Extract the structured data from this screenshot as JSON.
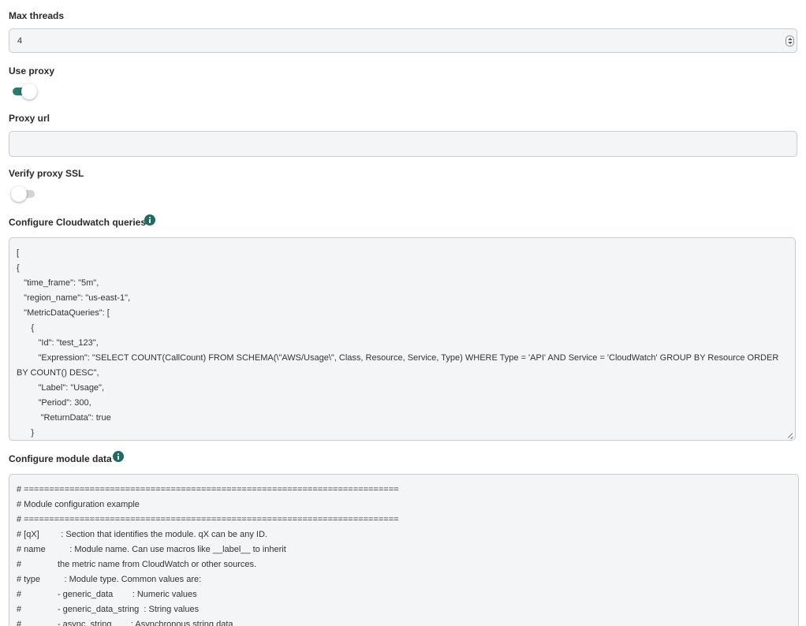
{
  "max_threads": {
    "label": "Max threads",
    "value": "4"
  },
  "use_proxy": {
    "label": "Use proxy",
    "enabled": true
  },
  "proxy_url": {
    "label": "Proxy url",
    "value": ""
  },
  "verify_proxy_ssl": {
    "label": "Verify proxy SSL",
    "enabled": false
  },
  "cloudwatch_queries": {
    "label": "Configure Cloudwatch queries",
    "content": "[\n{\n   \"time_frame\": \"5m\",\n   \"region_name\": \"us-east-1\",\n   \"MetricDataQueries\": [\n      {\n         \"Id\": \"test_123\",\n         \"Expression\": \"SELECT COUNT(CallCount) FROM SCHEMA(\\\"AWS/Usage\\\", Class, Resource, Service, Type) WHERE Type = 'API' AND Service = 'CloudWatch' GROUP BY Resource ORDER BY COUNT() DESC\",\n         \"Label\": \"Usage\",\n         \"Period\": 300,\n          \"ReturnData\": true\n      }"
  },
  "module_data": {
    "label": "Configure module data",
    "content": "# ==========================================================================\n# Module configuration example\n# ==========================================================================\n# [qX]         : Section that identifies the module. qX can be any ID.\n# name          : Module name. Can use macros like __label__ to inherit\n#               the metric name from CloudWatch or other sources.\n# type          : Module type. Common values are:\n#               - generic_data        : Numeric values\n#               - generic_data_string  : String values\n#               - async_string        : Asynchronous string data"
  },
  "icons": {
    "info": "info-icon",
    "spinner": "number-spinner-icon",
    "resize": "resize-grip-icon"
  },
  "colors": {
    "accent": "#2b7a6f",
    "info_icon": "#1e6b63",
    "field_background": "#f4f5f6",
    "field_border": "#c9cdd1"
  }
}
